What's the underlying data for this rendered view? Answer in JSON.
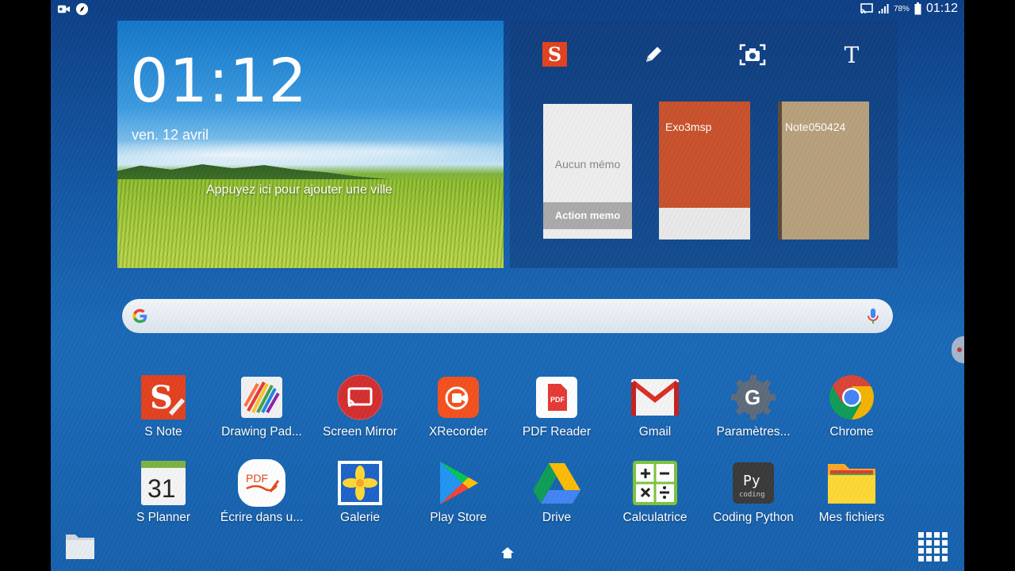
{
  "statusbar": {
    "left_icons": [
      "video-record-icon",
      "compass-icon"
    ],
    "right_icons": [
      "cast-icon",
      "signal-icon",
      "battery-icon"
    ],
    "battery_pct": "78%",
    "time": "01:12"
  },
  "clock_widget": {
    "time": "01:12",
    "date": "ven. 12 avril",
    "city_prompt": "Appuyez ici pour ajouter une ville"
  },
  "snote_widget": {
    "tools": [
      "snote-logo-icon",
      "pen-icon",
      "camera-icon",
      "text-icon"
    ],
    "text_tool_glyph": "T",
    "snote_glyph": "S",
    "cards": [
      {
        "title": "",
        "memo": "Aucun mémo",
        "action": "Action memo"
      },
      {
        "title": "Exo3msp"
      },
      {
        "title": "Note050424"
      }
    ]
  },
  "search": {
    "icons": [
      "google-g-icon",
      "mic-icon"
    ]
  },
  "colors": {
    "accent": "#e3411f",
    "exo3msp_cover": "#c9522c",
    "note_cover": "#b8a07c"
  },
  "apps_row1": [
    {
      "label": "S Note",
      "icon": "snote-icon"
    },
    {
      "label": "Drawing Pad...",
      "icon": "drawing-pad-icon"
    },
    {
      "label": "Screen Mirror",
      "icon": "screen-mirror-icon"
    },
    {
      "label": "XRecorder",
      "icon": "xrecorder-icon"
    },
    {
      "label": "PDF Reader",
      "icon": "pdf-reader-icon"
    },
    {
      "label": "Gmail",
      "icon": "gmail-icon"
    },
    {
      "label": "Paramètres...",
      "icon": "settings-icon"
    },
    {
      "label": "Chrome",
      "icon": "chrome-icon"
    }
  ],
  "apps_row2": [
    {
      "label": "S Planner",
      "icon": "s-planner-icon",
      "glyph": "31"
    },
    {
      "label": "Écrire dans u...",
      "icon": "write-pdf-icon",
      "glyph": "PDF"
    },
    {
      "label": "Galerie",
      "icon": "gallery-icon"
    },
    {
      "label": "Play Store",
      "icon": "play-store-icon"
    },
    {
      "label": "Drive",
      "icon": "drive-icon"
    },
    {
      "label": "Calculatrice",
      "icon": "calculator-icon"
    },
    {
      "label": "Coding Python",
      "icon": "coding-python-icon",
      "glyph": "Py",
      "subglyph": "coding"
    },
    {
      "label": "Mes fichiers",
      "icon": "my-files-icon"
    }
  ],
  "dock": [
    "folder-icon",
    "home-icon",
    "app-drawer-icon"
  ]
}
